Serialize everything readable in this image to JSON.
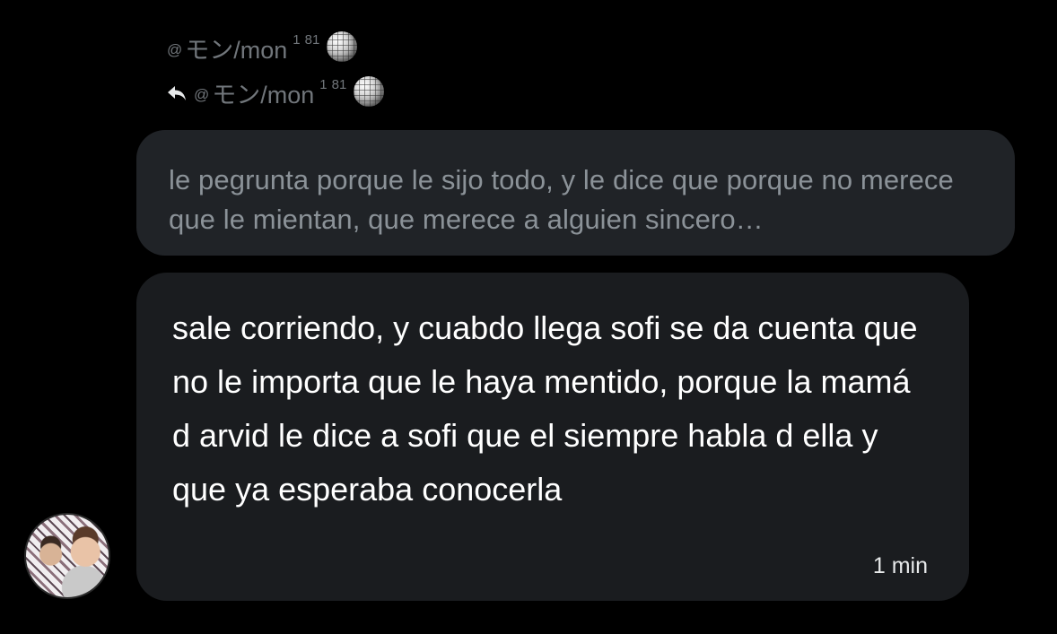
{
  "header": {
    "sender": {
      "prefix_symbol": "෕",
      "name": "モン/mon",
      "sup_a": "1",
      "sup_b": "81",
      "badge_icon": "disco-ball-icon"
    },
    "reply_to": {
      "reply_icon": "reply-arrow-icon",
      "prefix_symbol": "෕",
      "name": "モン/mon",
      "sup_a": "1",
      "sup_b": "81",
      "badge_icon": "disco-ball-icon"
    }
  },
  "quoted_message": {
    "text": "le pegrunta porque le sijo todo, y le dice que porque no merece que le mientan, que merece a alguien sincero…"
  },
  "message": {
    "text": "sale corriendo, y cuabdo llega sofi se da cuenta que no le importa que le haya mentido, porque la mamá d arvid le dice a sofi que el siempre habla d ella y que ya esperaba conocerla",
    "timestamp": "1 min"
  },
  "avatar": {
    "icon": "user-avatar"
  }
}
